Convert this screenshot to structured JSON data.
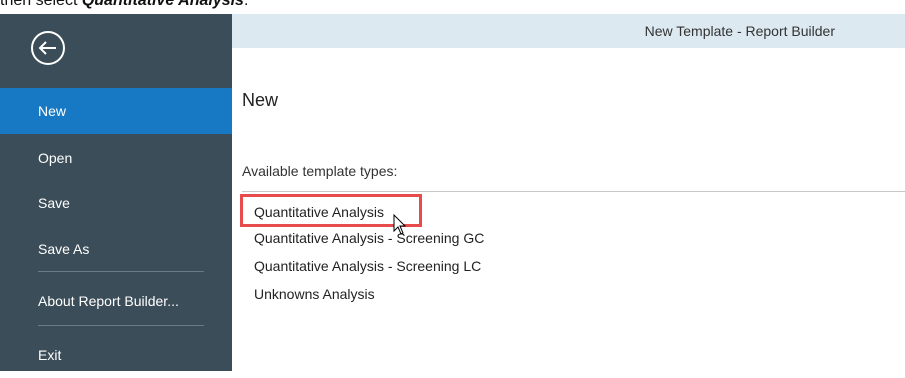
{
  "doc_text": {
    "prefix": "then select ",
    "emphasis": "Quantitative Analysis",
    "suffix": "."
  },
  "window": {
    "title": "New Template - Report Builder"
  },
  "sidebar": {
    "back_icon": "back-arrow-circle-icon",
    "items": [
      {
        "label": "New",
        "active": true
      },
      {
        "label": "Open"
      },
      {
        "label": "Save"
      },
      {
        "label": "Save As"
      },
      {
        "label": "About Report Builder..."
      },
      {
        "label": "Exit"
      }
    ]
  },
  "main": {
    "title": "New",
    "section_label": "Available template types:",
    "templates": [
      "Quantitative Analysis",
      "Quantitative Analysis - Screening GC",
      "Quantitative Analysis - Screening LC",
      "Unknowns Analysis"
    ],
    "highlighted_index": 0
  },
  "colors": {
    "sidebar_bg": "#3b4d58",
    "active_item": "#1779c4",
    "titlebar_bg": "#dde9f1",
    "highlight": "#e84b4b"
  }
}
